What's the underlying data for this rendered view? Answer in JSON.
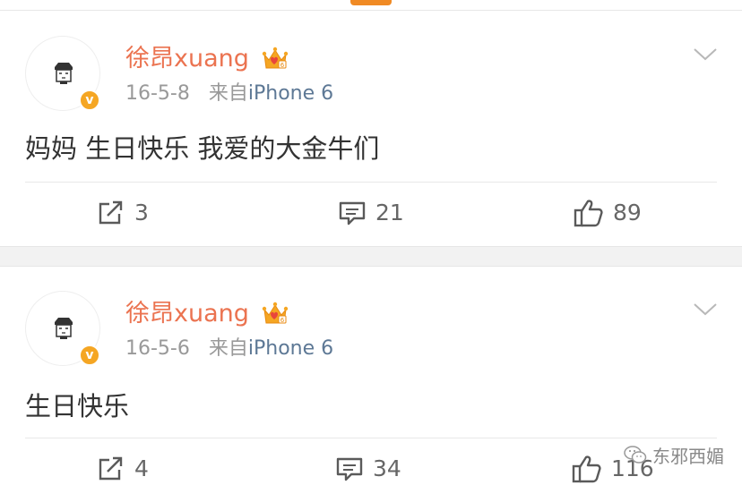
{
  "posts": [
    {
      "username": "徐昂xuang",
      "date": "16-5-8",
      "source_prefix": "来自",
      "device": "iPhone 6",
      "text": "妈妈 生日快乐 我爱的大金牛们",
      "reposts": "3",
      "comments": "21",
      "likes": "89"
    },
    {
      "username": "徐昂xuang",
      "date": "16-5-6",
      "source_prefix": "来自",
      "device": "iPhone 6",
      "text": "生日快乐",
      "reposts": "4",
      "comments": "34",
      "likes": "116"
    }
  ],
  "badge": {
    "verified_letter": "v"
  },
  "watermark": {
    "text": "东邪西媚"
  },
  "colors": {
    "username": "#eb7350",
    "accent": "#f08a24",
    "verified_badge": "#f5a623",
    "device_link": "#5d7895",
    "meta": "#999999",
    "action_icon": "#5a5a5a"
  },
  "icons": {
    "avatar": "cartoon-face-icon",
    "verified": "verified-v-icon",
    "membership": "crown-icon",
    "menu": "chevron-down-icon",
    "repost": "repost-icon",
    "comment": "comment-icon",
    "like": "thumbs-up-icon",
    "watermark": "wechat-icon"
  }
}
